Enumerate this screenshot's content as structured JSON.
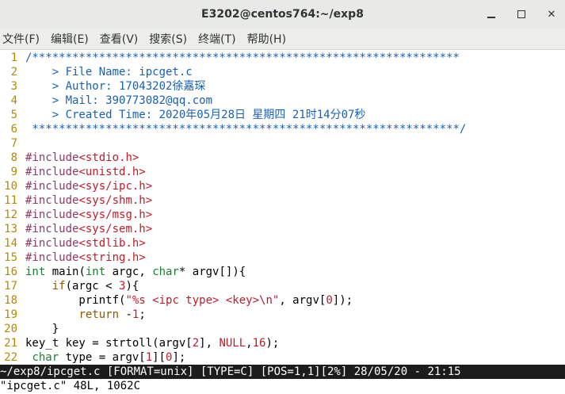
{
  "window": {
    "title": "E3202@centos764:~/exp8",
    "minimize_icon": "minimize-icon",
    "maximize_icon": "maximize-icon",
    "close_icon": "close-icon",
    "close_glyph": "✕"
  },
  "menubar": {
    "items": [
      "文件(F)",
      "编辑(E)",
      "查看(V)",
      "搜索(S)",
      "终端(T)",
      "帮助(H)"
    ]
  },
  "editor": {
    "lines": [
      {
        "n": "1",
        "parts": [
          {
            "t": "/****************************************************************",
            "c": "c-comment"
          }
        ]
      },
      {
        "n": "2",
        "parts": [
          {
            "t": "    > File Name: ipcget.c",
            "c": "c-comment"
          }
        ]
      },
      {
        "n": "3",
        "parts": [
          {
            "t": "    > Author: 17043202徐嘉琛",
            "c": "c-comment"
          }
        ]
      },
      {
        "n": "4",
        "parts": [
          {
            "t": "    > Mail: 390773082@qq.com",
            "c": "c-comment"
          }
        ]
      },
      {
        "n": "5",
        "parts": [
          {
            "t": "    > Created Time: 2020年05月28日 星期四 21时14分07秒",
            "c": "c-comment"
          }
        ]
      },
      {
        "n": "6",
        "parts": [
          {
            "t": " ****************************************************************/",
            "c": "c-comment"
          }
        ]
      },
      {
        "n": "7",
        "parts": []
      },
      {
        "n": "8",
        "parts": [
          {
            "t": "#include",
            "c": "c-pre"
          },
          {
            "t": "<stdio.h>",
            "c": "c-inc"
          }
        ]
      },
      {
        "n": "9",
        "parts": [
          {
            "t": "#include",
            "c": "c-pre"
          },
          {
            "t": "<unistd.h>",
            "c": "c-inc"
          }
        ]
      },
      {
        "n": "10",
        "parts": [
          {
            "t": "#include",
            "c": "c-pre"
          },
          {
            "t": "<sys/ipc.h>",
            "c": "c-inc"
          }
        ]
      },
      {
        "n": "11",
        "parts": [
          {
            "t": "#include",
            "c": "c-pre"
          },
          {
            "t": "<sys/shm.h>",
            "c": "c-inc"
          }
        ]
      },
      {
        "n": "12",
        "parts": [
          {
            "t": "#include",
            "c": "c-pre"
          },
          {
            "t": "<sys/msg.h>",
            "c": "c-inc"
          }
        ]
      },
      {
        "n": "13",
        "parts": [
          {
            "t": "#include",
            "c": "c-pre"
          },
          {
            "t": "<sys/sem.h>",
            "c": "c-inc"
          }
        ]
      },
      {
        "n": "14",
        "parts": [
          {
            "t": "#include",
            "c": "c-pre"
          },
          {
            "t": "<stdlib.h>",
            "c": "c-inc"
          }
        ]
      },
      {
        "n": "15",
        "parts": [
          {
            "t": "#include",
            "c": "c-pre"
          },
          {
            "t": "<string.h>",
            "c": "c-inc"
          }
        ]
      },
      {
        "n": "16",
        "parts": [
          {
            "t": "int",
            "c": "c-type"
          },
          {
            "t": " main(",
            "c": "c-var"
          },
          {
            "t": "int",
            "c": "c-type"
          },
          {
            "t": " argc, ",
            "c": "c-var"
          },
          {
            "t": "char",
            "c": "c-type"
          },
          {
            "t": "* argv[]){",
            "c": "c-var"
          }
        ]
      },
      {
        "n": "17",
        "parts": [
          {
            "t": "    ",
            "c": "c-var"
          },
          {
            "t": "if",
            "c": "c-kw"
          },
          {
            "t": "(argc < ",
            "c": "c-var"
          },
          {
            "t": "3",
            "c": "c-const"
          },
          {
            "t": "){",
            "c": "c-var"
          }
        ]
      },
      {
        "n": "18",
        "parts": [
          {
            "t": "        printf(",
            "c": "c-var"
          },
          {
            "t": "\"%s <ipc type> <key>",
            "c": "c-str"
          },
          {
            "t": "\\n",
            "c": "c-spec"
          },
          {
            "t": "\"",
            "c": "c-str"
          },
          {
            "t": ", argv[",
            "c": "c-var"
          },
          {
            "t": "0",
            "c": "c-const"
          },
          {
            "t": "]);",
            "c": "c-var"
          }
        ]
      },
      {
        "n": "19",
        "parts": [
          {
            "t": "        ",
            "c": "c-var"
          },
          {
            "t": "return",
            "c": "c-kw"
          },
          {
            "t": " -",
            "c": "c-var"
          },
          {
            "t": "1",
            "c": "c-const"
          },
          {
            "t": ";",
            "c": "c-var"
          }
        ]
      },
      {
        "n": "20",
        "parts": [
          {
            "t": "    }",
            "c": "c-var"
          }
        ]
      },
      {
        "n": "21",
        "parts": [
          {
            "t": "key_t key = strtoll(argv[",
            "c": "c-var"
          },
          {
            "t": "2",
            "c": "c-const"
          },
          {
            "t": "], ",
            "c": "c-var"
          },
          {
            "t": "NULL",
            "c": "c-const"
          },
          {
            "t": ",",
            "c": "c-var"
          },
          {
            "t": "16",
            "c": "c-const"
          },
          {
            "t": ");",
            "c": "c-var"
          }
        ]
      },
      {
        "n": "22",
        "parts": [
          {
            "t": " ",
            "c": "c-var"
          },
          {
            "t": "char",
            "c": "c-type"
          },
          {
            "t": " type = argv[",
            "c": "c-var"
          },
          {
            "t": "1",
            "c": "c-const"
          },
          {
            "t": "][",
            "c": "c-var"
          },
          {
            "t": "0",
            "c": "c-const"
          },
          {
            "t": "];",
            "c": "c-var"
          }
        ]
      }
    ]
  },
  "statusline": {
    "text": "~/exp8/ipcget.c [FORMAT=unix] [TYPE=C] [POS=1,1][2%] 28/05/20 - 21:15"
  },
  "cmdline": {
    "text": "\"ipcget.c\" 48L, 1062C"
  }
}
